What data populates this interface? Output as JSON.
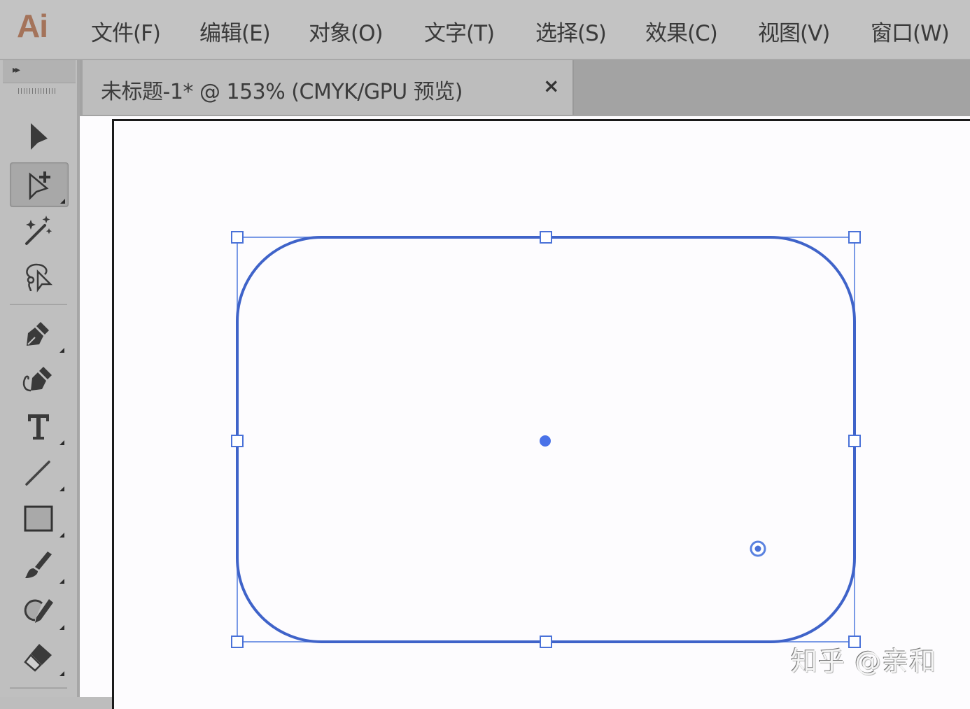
{
  "app": {
    "logo": "Ai",
    "brand_color": "#a4735a"
  },
  "menu": {
    "items": [
      {
        "label": "文件(F)"
      },
      {
        "label": "编辑(E)"
      },
      {
        "label": "对象(O)"
      },
      {
        "label": "文字(T)"
      },
      {
        "label": "选择(S)"
      },
      {
        "label": "效果(C)"
      },
      {
        "label": "视图(V)"
      },
      {
        "label": "窗口(W)"
      }
    ]
  },
  "document": {
    "tab_title": "未标题-1* @ 153% (CMYK/GPU 预览)",
    "close_glyph": "×",
    "zoom": "153%",
    "color_mode": "CMYK/GPU 预览"
  },
  "toolbar": {
    "collapse_glyph": "▸▸",
    "tools": [
      {
        "name": "selection-tool",
        "icon": "arrow-filled",
        "active": false,
        "has_submenu": false
      },
      {
        "name": "direct-selection-tool",
        "icon": "arrow-outline-plus",
        "active": true,
        "has_submenu": true
      },
      {
        "name": "magic-wand-tool",
        "icon": "magic-wand",
        "active": false,
        "has_submenu": false
      },
      {
        "name": "lasso-tool",
        "icon": "lasso",
        "active": false,
        "has_submenu": false
      },
      {
        "name": "pen-tool",
        "icon": "pen-nib",
        "active": false,
        "has_submenu": true
      },
      {
        "name": "curvature-tool",
        "icon": "curvature-pen",
        "active": false,
        "has_submenu": false
      },
      {
        "name": "type-tool",
        "icon": "type-T",
        "active": false,
        "has_submenu": true
      },
      {
        "name": "line-segment-tool",
        "icon": "line",
        "active": false,
        "has_submenu": true
      },
      {
        "name": "rectangle-tool",
        "icon": "rectangle",
        "active": false,
        "has_submenu": true
      },
      {
        "name": "paintbrush-tool",
        "icon": "brush",
        "active": false,
        "has_submenu": true
      },
      {
        "name": "shaper-tool",
        "icon": "shaper",
        "active": false,
        "has_submenu": true
      },
      {
        "name": "eraser-tool",
        "icon": "eraser",
        "active": false,
        "has_submenu": true
      }
    ]
  },
  "canvas": {
    "selected_shape": "rounded-rectangle",
    "selection_color": "#4a72d8",
    "stroke_color": "#3f63c9"
  },
  "watermark": {
    "text": "知乎 @亲和"
  }
}
